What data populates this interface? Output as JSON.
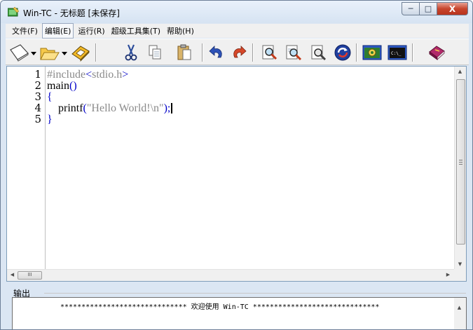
{
  "window": {
    "title": "Win-TC - 无标题 [未保存]",
    "minimize_glyph": "─",
    "maximize_glyph": "□",
    "close_glyph": "X"
  },
  "menu": [
    {
      "label": "文件(F)"
    },
    {
      "label": "编辑(E)"
    },
    {
      "label": "运行(R)"
    },
    {
      "label": "超级工具集(T)"
    },
    {
      "label": "帮助(H)"
    }
  ],
  "toolbar": [
    {
      "icon": "new-file-icon"
    },
    {
      "icon": "open-folder-icon"
    },
    {
      "icon": "save-disk-icon"
    },
    {
      "icon": "cut-icon"
    },
    {
      "icon": "copy-icon"
    },
    {
      "icon": "paste-icon"
    },
    {
      "icon": "undo-icon"
    },
    {
      "icon": "redo-icon"
    },
    {
      "icon": "find-icon"
    },
    {
      "icon": "find-next-icon"
    },
    {
      "icon": "replace-icon"
    },
    {
      "icon": "refresh-icon"
    },
    {
      "icon": "compile-icon"
    },
    {
      "icon": "console-icon"
    },
    {
      "icon": "help-book-icon"
    }
  ],
  "editor": {
    "line_numbers": [
      "1",
      "2",
      "3",
      "4",
      "5"
    ],
    "lines": [
      {
        "pre": "#include",
        "paren_open": "<",
        "id": "stdio.h",
        "paren_close": ">"
      },
      {
        "id": "main",
        "paren": "()"
      },
      {
        "paren": "{"
      },
      {
        "indent": "    ",
        "id": "printf",
        "paren_open": "(",
        "str": "\"Hello World!\\n\"",
        "paren_close": ");"
      },
      {
        "paren": "}"
      }
    ],
    "hscroll_thumb_glyph": "III",
    "console_icon_text": "C:\\_"
  },
  "output": {
    "label": "输出",
    "message": "****************************** 欢迎使用 Win-TC ******************************"
  },
  "colors": {
    "titlebar": "#dbe6f3",
    "close_button": "#c7452d",
    "code_paren": "#0000c8",
    "code_preprocessor": "#8a8a8a",
    "code_string": "#8a8a8a"
  }
}
